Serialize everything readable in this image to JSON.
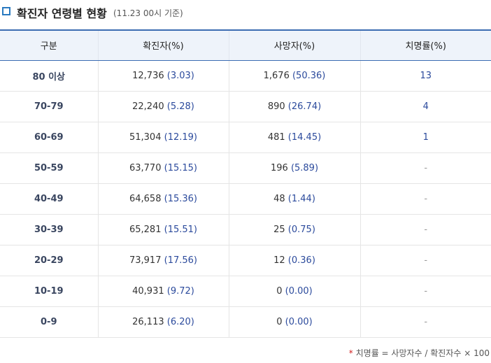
{
  "header": {
    "title": "확진자 연령별 현황",
    "subtitle": "(11.23 00시 기준)"
  },
  "table": {
    "columns": [
      "구분",
      "확진자(%)",
      "사망자(%)",
      "치명률(%)"
    ],
    "rows": [
      {
        "group": "80 이상",
        "confirmed": "12,736",
        "confirmed_pct": "(3.03)",
        "deaths": "1,676",
        "deaths_pct": "(50.36)",
        "fatality": "13"
      },
      {
        "group": "70-79",
        "confirmed": "22,240",
        "confirmed_pct": "(5.28)",
        "deaths": "890",
        "deaths_pct": "(26.74)",
        "fatality": "4"
      },
      {
        "group": "60-69",
        "confirmed": "51,304",
        "confirmed_pct": "(12.19)",
        "deaths": "481",
        "deaths_pct": "(14.45)",
        "fatality": "1"
      },
      {
        "group": "50-59",
        "confirmed": "63,770",
        "confirmed_pct": "(15.15)",
        "deaths": "196",
        "deaths_pct": "(5.89)",
        "fatality": "-"
      },
      {
        "group": "40-49",
        "confirmed": "64,658",
        "confirmed_pct": "(15.36)",
        "deaths": "48",
        "deaths_pct": "(1.44)",
        "fatality": "-"
      },
      {
        "group": "30-39",
        "confirmed": "65,281",
        "confirmed_pct": "(15.51)",
        "deaths": "25",
        "deaths_pct": "(0.75)",
        "fatality": "-"
      },
      {
        "group": "20-29",
        "confirmed": "73,917",
        "confirmed_pct": "(17.56)",
        "deaths": "12",
        "deaths_pct": "(0.36)",
        "fatality": "-"
      },
      {
        "group": "10-19",
        "confirmed": "40,931",
        "confirmed_pct": "(9.72)",
        "deaths": "0",
        "deaths_pct": "(0.00)",
        "fatality": "-"
      },
      {
        "group": "0-9",
        "confirmed": "26,113",
        "confirmed_pct": "(6.20)",
        "deaths": "0",
        "deaths_pct": "(0.00)",
        "fatality": "-"
      }
    ]
  },
  "footnote": {
    "marker": "*",
    "text": "치명률 = 사망자수 / 확진자수 × 100"
  },
  "colors": {
    "accent": "#3b6cb2",
    "header_bg": "#eef3fa",
    "pct_text": "#2b4a9c",
    "footnote_marker": "#d11e1e"
  }
}
